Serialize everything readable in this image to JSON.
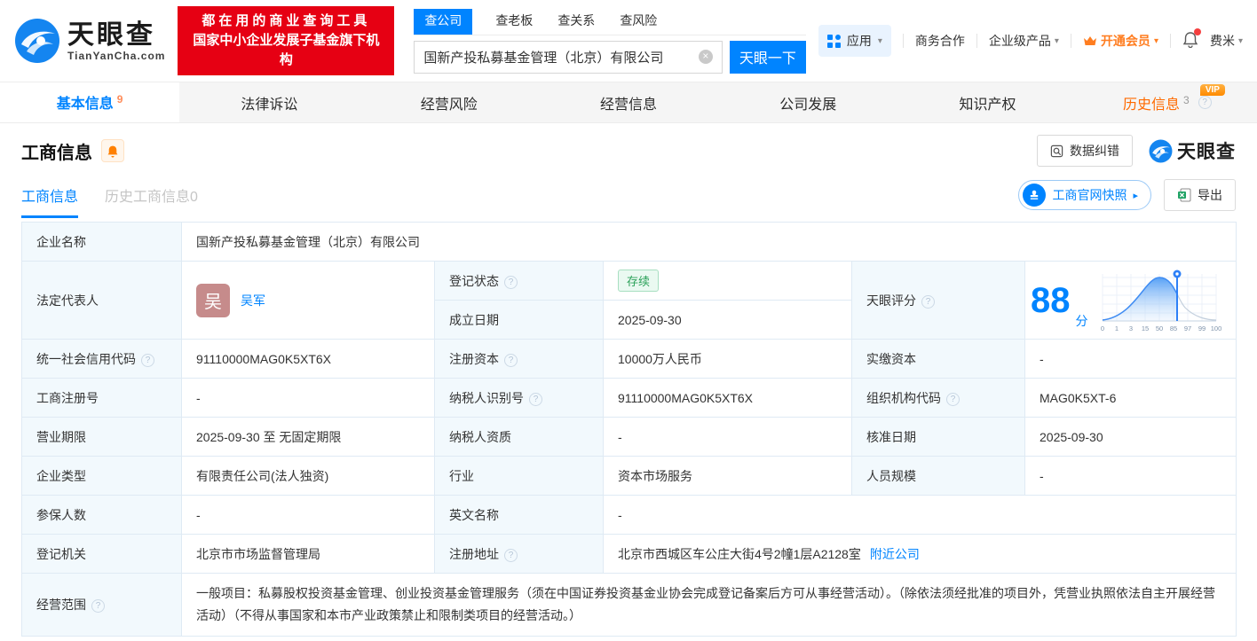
{
  "icons": {
    "help": "?",
    "caret": "▾",
    "arrow_right": "▸",
    "close": "×",
    "vip": "VIP"
  },
  "header": {
    "logo_title": "天眼查",
    "logo_domain": "TianYanCha.com",
    "banner_line1": "都在用的商业查询工具",
    "banner_line2": "国家中小企业发展子基金旗下机构",
    "search_tabs": [
      "查公司",
      "查老板",
      "查关系",
      "查风险"
    ],
    "search_value": "国新产投私募基金管理（北京）有限公司",
    "search_button": "天眼一下",
    "nav_apps": "应用",
    "nav_biz": "商务合作",
    "nav_enterprise": "企业级产品",
    "nav_vip": "开通会员",
    "nav_user": "费米"
  },
  "tabs": [
    {
      "label": "基本信息",
      "count": "9"
    },
    {
      "label": "法律诉讼",
      "count": ""
    },
    {
      "label": "经营风险",
      "count": ""
    },
    {
      "label": "经营信息",
      "count": ""
    },
    {
      "label": "公司发展",
      "count": ""
    },
    {
      "label": "知识产权",
      "count": ""
    },
    {
      "label": "历史信息",
      "count": "3"
    }
  ],
  "section": {
    "title": "工商信息",
    "correction": "数据纠错",
    "brand": "天眼查",
    "subtab_active": "工商信息",
    "subtab_history": "历史工商信息0",
    "snapshot": "工商官网快照",
    "export": "导出"
  },
  "fields": {
    "company_name": {
      "label": "企业名称",
      "value": "国新产投私募基金管理（北京）有限公司"
    },
    "legal_rep": {
      "label": "法定代表人",
      "avatar": "吴",
      "name": "吴军"
    },
    "reg_status": {
      "label": "登记状态",
      "value": "存续"
    },
    "establish_date": {
      "label": "成立日期",
      "value": "2025-09-30"
    },
    "score": {
      "label": "天眼评分",
      "value": "88",
      "unit": "分"
    },
    "credit_code": {
      "label": "统一社会信用代码",
      "value": "91110000MAG0K5XT6X"
    },
    "reg_capital": {
      "label": "注册资本",
      "value": "10000万人民币"
    },
    "paid_capital": {
      "label": "实缴资本",
      "value": "-"
    },
    "reg_number": {
      "label": "工商注册号",
      "value": "-"
    },
    "taxpayer_id": {
      "label": "纳税人识别号",
      "value": "91110000MAG0K5XT6X"
    },
    "org_code": {
      "label": "组织机构代码",
      "value": "MAG0K5XT-6"
    },
    "business_term": {
      "label": "营业期限",
      "value": "2025-09-30 至 无固定期限"
    },
    "taxpayer_quality": {
      "label": "纳税人资质",
      "value": "-"
    },
    "approval_date": {
      "label": "核准日期",
      "value": "2025-09-30"
    },
    "company_type": {
      "label": "企业类型",
      "value": "有限责任公司(法人独资)"
    },
    "industry": {
      "label": "行业",
      "value": "资本市场服务"
    },
    "staff_size": {
      "label": "人员规模",
      "value": "-"
    },
    "insured_count": {
      "label": "参保人数",
      "value": "-"
    },
    "english_name": {
      "label": "英文名称",
      "value": "-"
    },
    "reg_authority": {
      "label": "登记机关",
      "value": "北京市市场监督管理局"
    },
    "reg_address": {
      "label": "注册地址",
      "value": "北京市西城区车公庄大街4号2幢1层A2128室",
      "link": "附近公司"
    },
    "business_scope": {
      "label": "经营范围",
      "value": "一般项目：私募股权投资基金管理、创业投资基金管理服务（须在中国证券投资基金业协会完成登记备案后方可从事经营活动）。（除依法须经批准的项目外，凭营业执照依法自主开展经营活动）（不得从事国家和本市产业政策禁止和限制类项目的经营活动。）"
    }
  },
  "score_chart": {
    "type": "area",
    "ticks": [
      "0",
      "1",
      "3",
      "15",
      "50",
      "85",
      "97",
      "99",
      "100"
    ],
    "marker_value": 88
  }
}
